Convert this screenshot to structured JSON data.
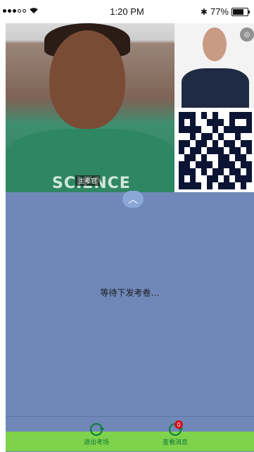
{
  "status_bar": {
    "time": "1:20 PM",
    "battery": "77%"
  },
  "labels": {
    "examiner": "主考官",
    "waiting": "等待下发考卷…"
  },
  "shirt_text": "SCIENCE",
  "nav": {
    "exit_label": "退出考场",
    "messages_label": "查看消息",
    "messages_badge": "0"
  },
  "colors": {
    "accent": "#6f88b8",
    "green": "#7fd24b",
    "badge": "#d0101a"
  },
  "icons": {
    "camera": "camera-icon",
    "collapse": "chevron-up-icon",
    "exit": "exit-icon",
    "message": "message-icon"
  }
}
